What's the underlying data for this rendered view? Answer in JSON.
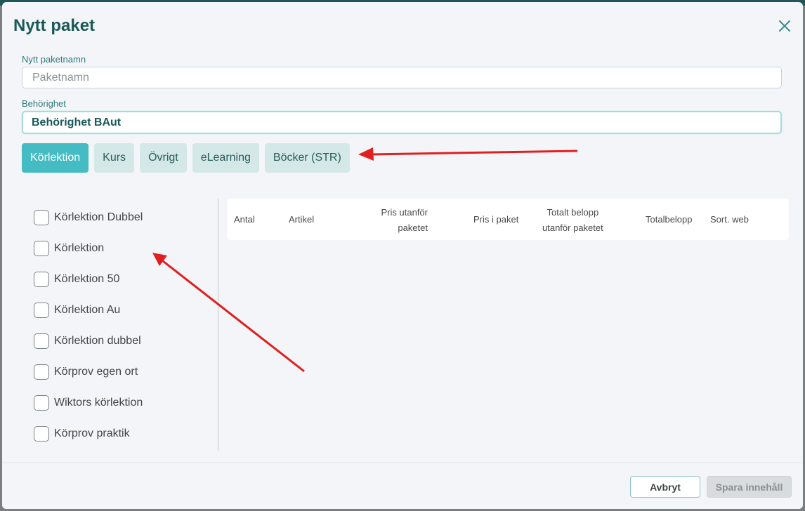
{
  "modal": {
    "title": "Nytt paket",
    "close_icon": "close-icon"
  },
  "form": {
    "name_label": "Nytt paketnamn",
    "name_placeholder": "Paketnamn",
    "name_value": "",
    "permission_label": "Behörighet",
    "permission_value": "Behörighet BAut"
  },
  "tabs": [
    {
      "label": "Körlektion",
      "active": true
    },
    {
      "label": "Kurs",
      "active": false
    },
    {
      "label": "Övrigt",
      "active": false
    },
    {
      "label": "eLearning",
      "active": false
    },
    {
      "label": "Böcker (STR)",
      "active": false
    }
  ],
  "articles": [
    {
      "label": "Körlektion Dubbel",
      "checked": false
    },
    {
      "label": "Körlektion",
      "checked": false
    },
    {
      "label": "Körlektion 50",
      "checked": false
    },
    {
      "label": "Körlektion Au",
      "checked": false
    },
    {
      "label": "Körlektion dubbel",
      "checked": false
    },
    {
      "label": "Körprov egen ort",
      "checked": false
    },
    {
      "label": "Wiktors körlektion",
      "checked": false
    },
    {
      "label": "Körprov praktik",
      "checked": false
    }
  ],
  "table": {
    "headers": {
      "count": "Antal",
      "article": "Artikel",
      "price_outside_1": "Pris utanför",
      "price_outside_2": "paketet",
      "price_in_package": "Pris i paket",
      "total_outside_1": "Totalt belopp",
      "total_outside_2": "utanför paketet",
      "total_amount": "Totalbelopp",
      "sort_web": "Sort. web"
    },
    "rows": []
  },
  "footer": {
    "cancel_label": "Avbryt",
    "save_label": "Spara innehåll"
  },
  "colors": {
    "accent": "#45bcc3",
    "title": "#1b5858",
    "annotation_arrow": "#e02020"
  }
}
